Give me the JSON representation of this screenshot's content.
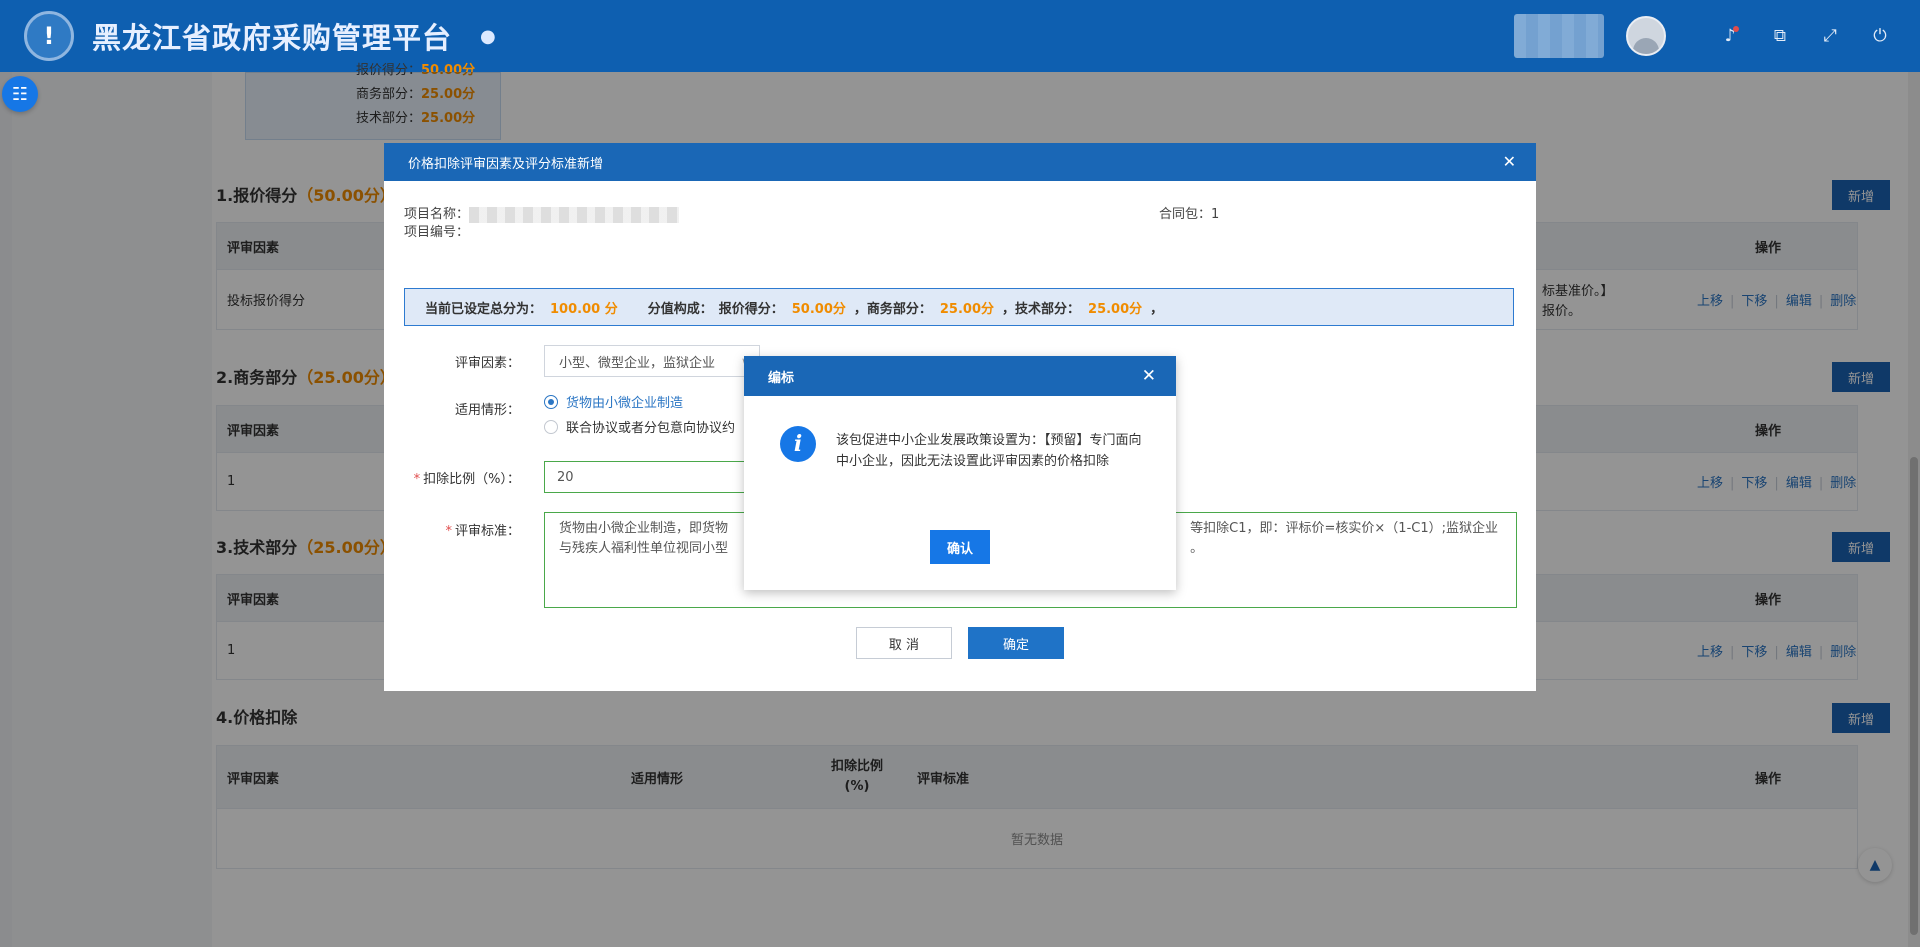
{
  "header": {
    "app_title": "黑龙江省政府采购管理平台",
    "logo_char": "!",
    "icons": [
      "location-icon",
      "bell-icon",
      "window-icon",
      "fullscreen-icon",
      "power-icon"
    ]
  },
  "score_box": {
    "rows": [
      {
        "label": "报价得分：",
        "value": "50.00分"
      },
      {
        "label": "商务部分：",
        "value": "25.00分"
      },
      {
        "label": "技术部分：",
        "value": "25.00分"
      }
    ]
  },
  "sections": [
    {
      "title": "1.报价得分",
      "score": "（50.00分）"
    },
    {
      "title": "2.商务部分",
      "score": "（25.00分）"
    },
    {
      "title": "3.技术部分",
      "score": "（25.00分）"
    },
    {
      "title": "4.价格扣除",
      "score": ""
    }
  ],
  "buttons": {
    "add": "新增"
  },
  "table": {
    "col_factor": "评审因素",
    "col_ops": "操作",
    "col_situation": "适用情形",
    "col_ratio": "扣除比例(%)",
    "col_standard": "评审标准",
    "ops": [
      "上移",
      "下移",
      "编辑",
      "删除"
    ],
    "row1_factor": "投标报价得分",
    "row1_text_a": "标基准价。】",
    "row1_text_b": "报价。",
    "row2_factor": "1",
    "row3_factor": "1",
    "nodata": "暂无数据"
  },
  "dialog": {
    "title": "价格扣除评审因素及评分标准新增",
    "project_name_label": "项目名称：",
    "project_no_label": "项目编号：",
    "contract_label": "合同包：",
    "contract_value": "1",
    "summary": {
      "total_label": "当前已设定总分为：",
      "total_value": "100.00 分",
      "composition_label": "分值构成：",
      "price_label": "报价得分：",
      "price_value": "50.00分",
      "business_label": "，商务部分：",
      "business_value": "25.00分",
      "tech_label": "，技术部分：",
      "tech_value": "25.00分",
      "tail": "，"
    },
    "factor_label": "评审因素：",
    "factor_value": "小型、微型企业，监狱企业",
    "situation_label": "适用情形：",
    "radio1": "货物由小微企业制造",
    "radio2": "联合协议或者分包意向协议约",
    "ratio_label": "扣除比例（%）：",
    "ratio_value": "20",
    "standard_label": "评审标准：",
    "standard_line1_left": "货物由小微企业制造，即货物",
    "standard_line2_left": "与残疾人福利性单位视同小型",
    "standard_line1_right": "等扣除C1，即：评标价=核实价×（1-C1）;监狱企业",
    "standard_line2_right": "。",
    "cancel": "取 消",
    "confirm": "确定"
  },
  "alert": {
    "title": "编标",
    "icon": "i",
    "message": "该包促进中小企业发展政策设置为：【预留】专门面向中小企业，因此无法设置此评审因素的价格扣除",
    "button": "确认"
  }
}
